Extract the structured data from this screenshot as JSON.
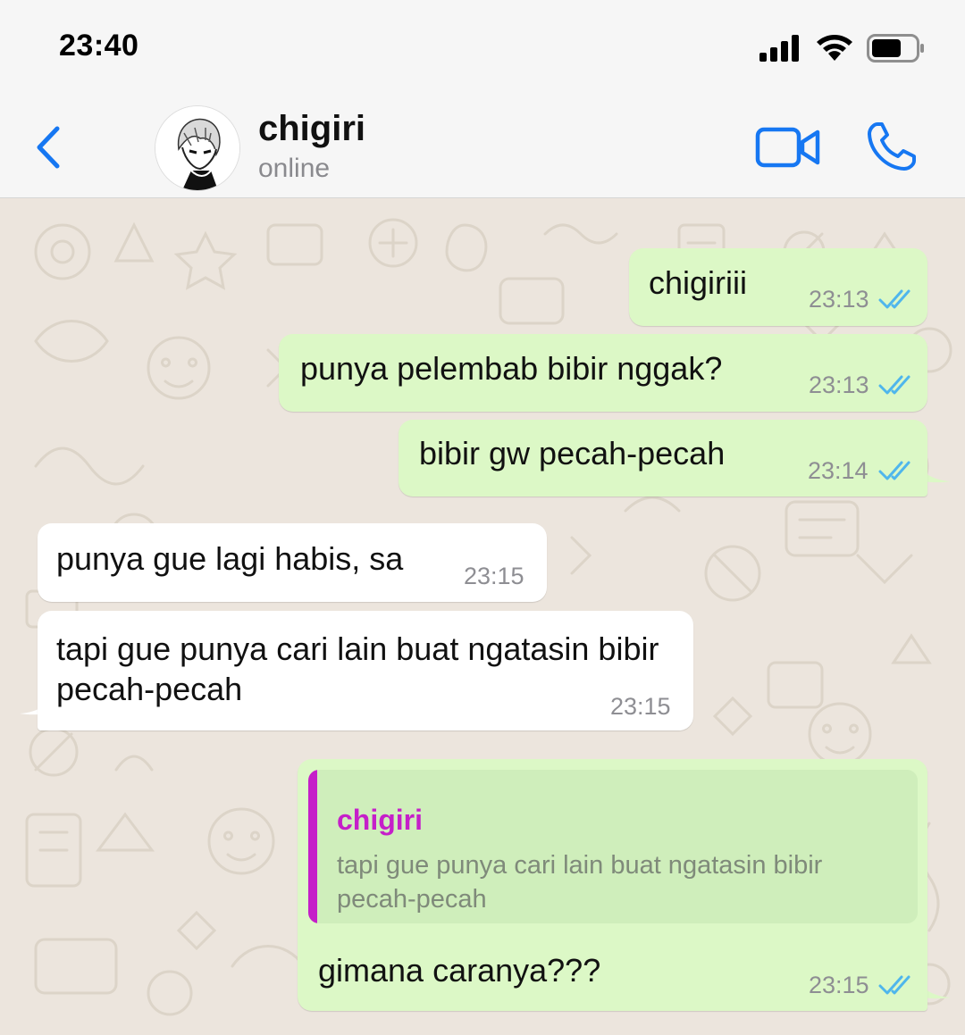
{
  "status_bar": {
    "time": "23:40"
  },
  "header": {
    "contact_name": "chigiri",
    "contact_status": "online"
  },
  "messages": [
    {
      "direction": "outgoing",
      "text": "chigiriii",
      "time": "23:13",
      "read": true
    },
    {
      "direction": "outgoing",
      "text": "punya pelembab bibir nggak?",
      "time": "23:13",
      "read": true
    },
    {
      "direction": "outgoing",
      "text": "bibir gw pecah-pecah",
      "time": "23:14",
      "read": true
    },
    {
      "direction": "incoming",
      "text": "punya gue lagi habis, sa",
      "time": "23:15"
    },
    {
      "direction": "incoming",
      "text": "tapi gue punya cari lain buat ngatasin bibir pecah-pecah",
      "time": "23:15"
    },
    {
      "direction": "outgoing",
      "reply_to": {
        "name": "chigiri",
        "text": "tapi gue punya cari lain buat ngatasin bibir pecah-pecah"
      },
      "text": "gimana caranya???",
      "time": "23:15",
      "read": true
    }
  ],
  "colors": {
    "accent": "#1677f2",
    "outgoing_bubble": "#dcf8c6",
    "incoming_bubble": "#ffffff",
    "chat_background": "#ece5dd",
    "reply_name": "#c51fc9",
    "read_ticks": "#4fb6ec"
  }
}
